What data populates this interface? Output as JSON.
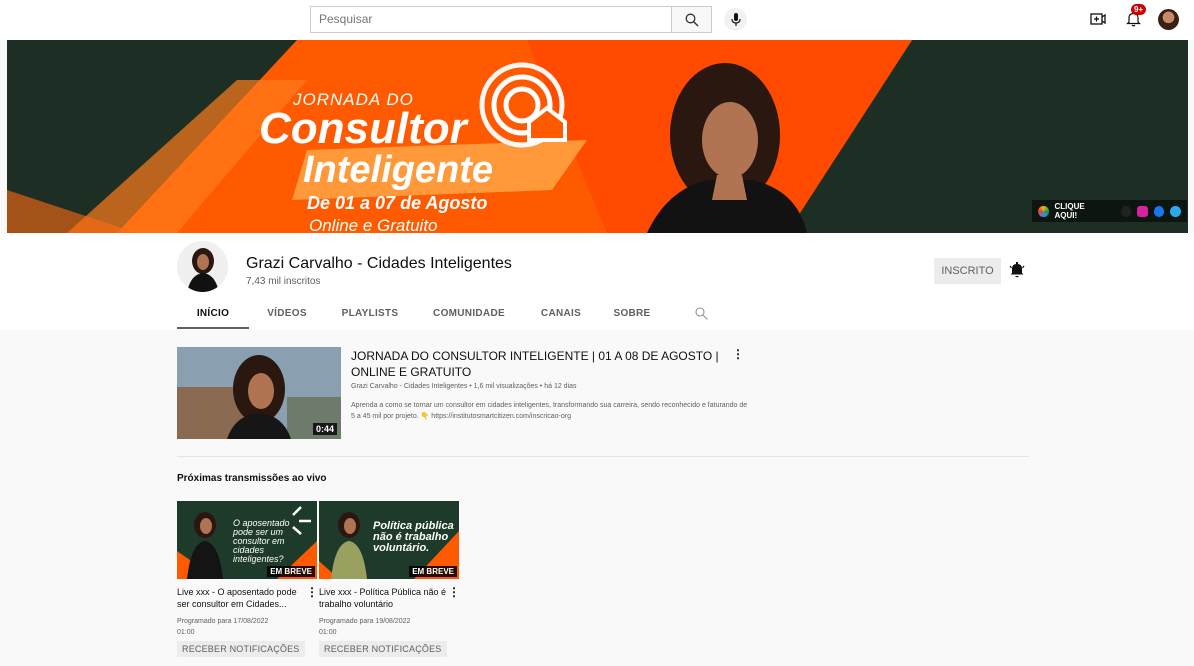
{
  "colors": {
    "accent": "#ff5a00",
    "banner_dark": "#1e2e25",
    "red": "#cc0000"
  },
  "topbar": {
    "search_placeholder": "Pesquisar",
    "notifications_badge": "9+",
    "icons": [
      "search-icon",
      "mic-icon",
      "create-video-icon",
      "bell-icon",
      "avatar"
    ]
  },
  "banner": {
    "line1": "JORNADA DO",
    "line2": "Consultor",
    "line3": "Inteligente",
    "dates": "De 01 a 07 de Agosto",
    "online": "Online e Gratuito",
    "cta": "CLIQUE AQUI!"
  },
  "channel": {
    "name": "Grazi Carvalho - Cidades Inteligentes",
    "subscribers": "7,43 mil inscritos",
    "subscribe_label": "INSCRITO"
  },
  "tabs": [
    "INÍCIO",
    "VÍDEOS",
    "PLAYLISTS",
    "COMUNIDADE",
    "CANAIS",
    "SOBRE"
  ],
  "featured": {
    "title": "JORNADA DO CONSULTOR INTELIGENTE | 01 A 08 DE AGOSTO | ONLINE E GRATUITO",
    "meta": "Grazi Carvalho - Cidades Inteligentes • 1,6 mil visualizações • há 12 dias",
    "description": "Aprenda a como se tornar um consultor em cidades inteligentes, transformando sua carreira, sendo reconhecido e faturando de 5 a 45 mil por projeto. 👇 https://institutosmartcitizen.com/inscricao-org",
    "duration": "0:44"
  },
  "upcoming": {
    "section_title": "Próximas transmissões ao vivo",
    "items": [
      {
        "thumb_text": "O aposentado pode ser um consultor em cidades inteligentes?",
        "badge": "EM BREVE",
        "title": "Live xxx - O aposentado pode ser consultor em Cidades...",
        "scheduled": "Programado para 17/08/2022 01:00",
        "button": "RECEBER NOTIFICAÇÕES"
      },
      {
        "thumb_text": "Política pública não é trabalho voluntário.",
        "badge": "EM BREVE",
        "title": "Live xxx - Política Pública não é trabalho voluntário",
        "scheduled": "Programado para 19/08/2022 01:00",
        "button": "RECEBER NOTIFICAÇÕES"
      }
    ]
  }
}
